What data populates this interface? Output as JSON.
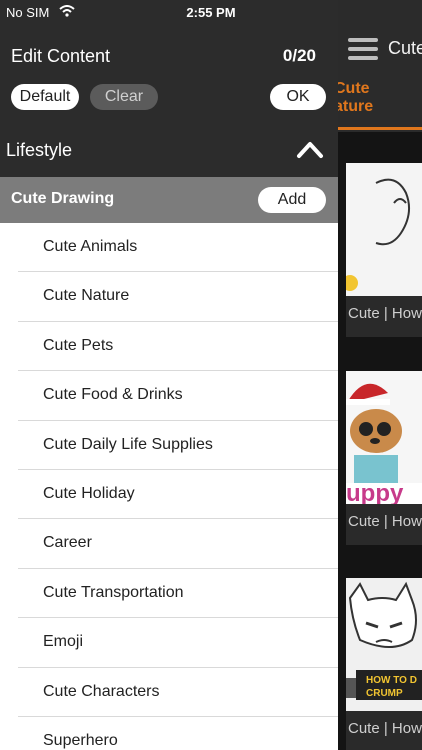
{
  "status_bar": {
    "carrier": "No SIM",
    "time": "2:55 PM"
  },
  "background": {
    "header_title": "Cute",
    "active_tab": "Cute\nature",
    "cards": [
      {
        "caption": "Cute | How"
      },
      {
        "caption": "Cute | How"
      },
      {
        "caption": "Cute | How"
      }
    ],
    "card2_overlay": "uppy",
    "card3_overlay": "HOW TO D\nCRUMP"
  },
  "drawer": {
    "title": "Edit Content",
    "counter": "0/20",
    "default_label": "Default",
    "clear_label": "Clear",
    "ok_label": "OK",
    "category": "Lifestyle",
    "group": {
      "label": "Cute Drawing",
      "add_label": "Add"
    },
    "items": [
      {
        "label": "Cute Animals"
      },
      {
        "label": "Cute Nature"
      },
      {
        "label": "Cute Pets"
      },
      {
        "label": "Cute Food & Drinks"
      },
      {
        "label": "Cute Daily Life Supplies"
      },
      {
        "label": "Cute Holiday"
      },
      {
        "label": "Career"
      },
      {
        "label": "Cute Transportation"
      },
      {
        "label": "Emoji"
      },
      {
        "label": "Cute Characters"
      },
      {
        "label": "Superhero"
      }
    ]
  },
  "colors": {
    "accent": "#e0771d",
    "drawer_bg": "#2c2c2c",
    "group_bg": "#7c7c7c"
  }
}
